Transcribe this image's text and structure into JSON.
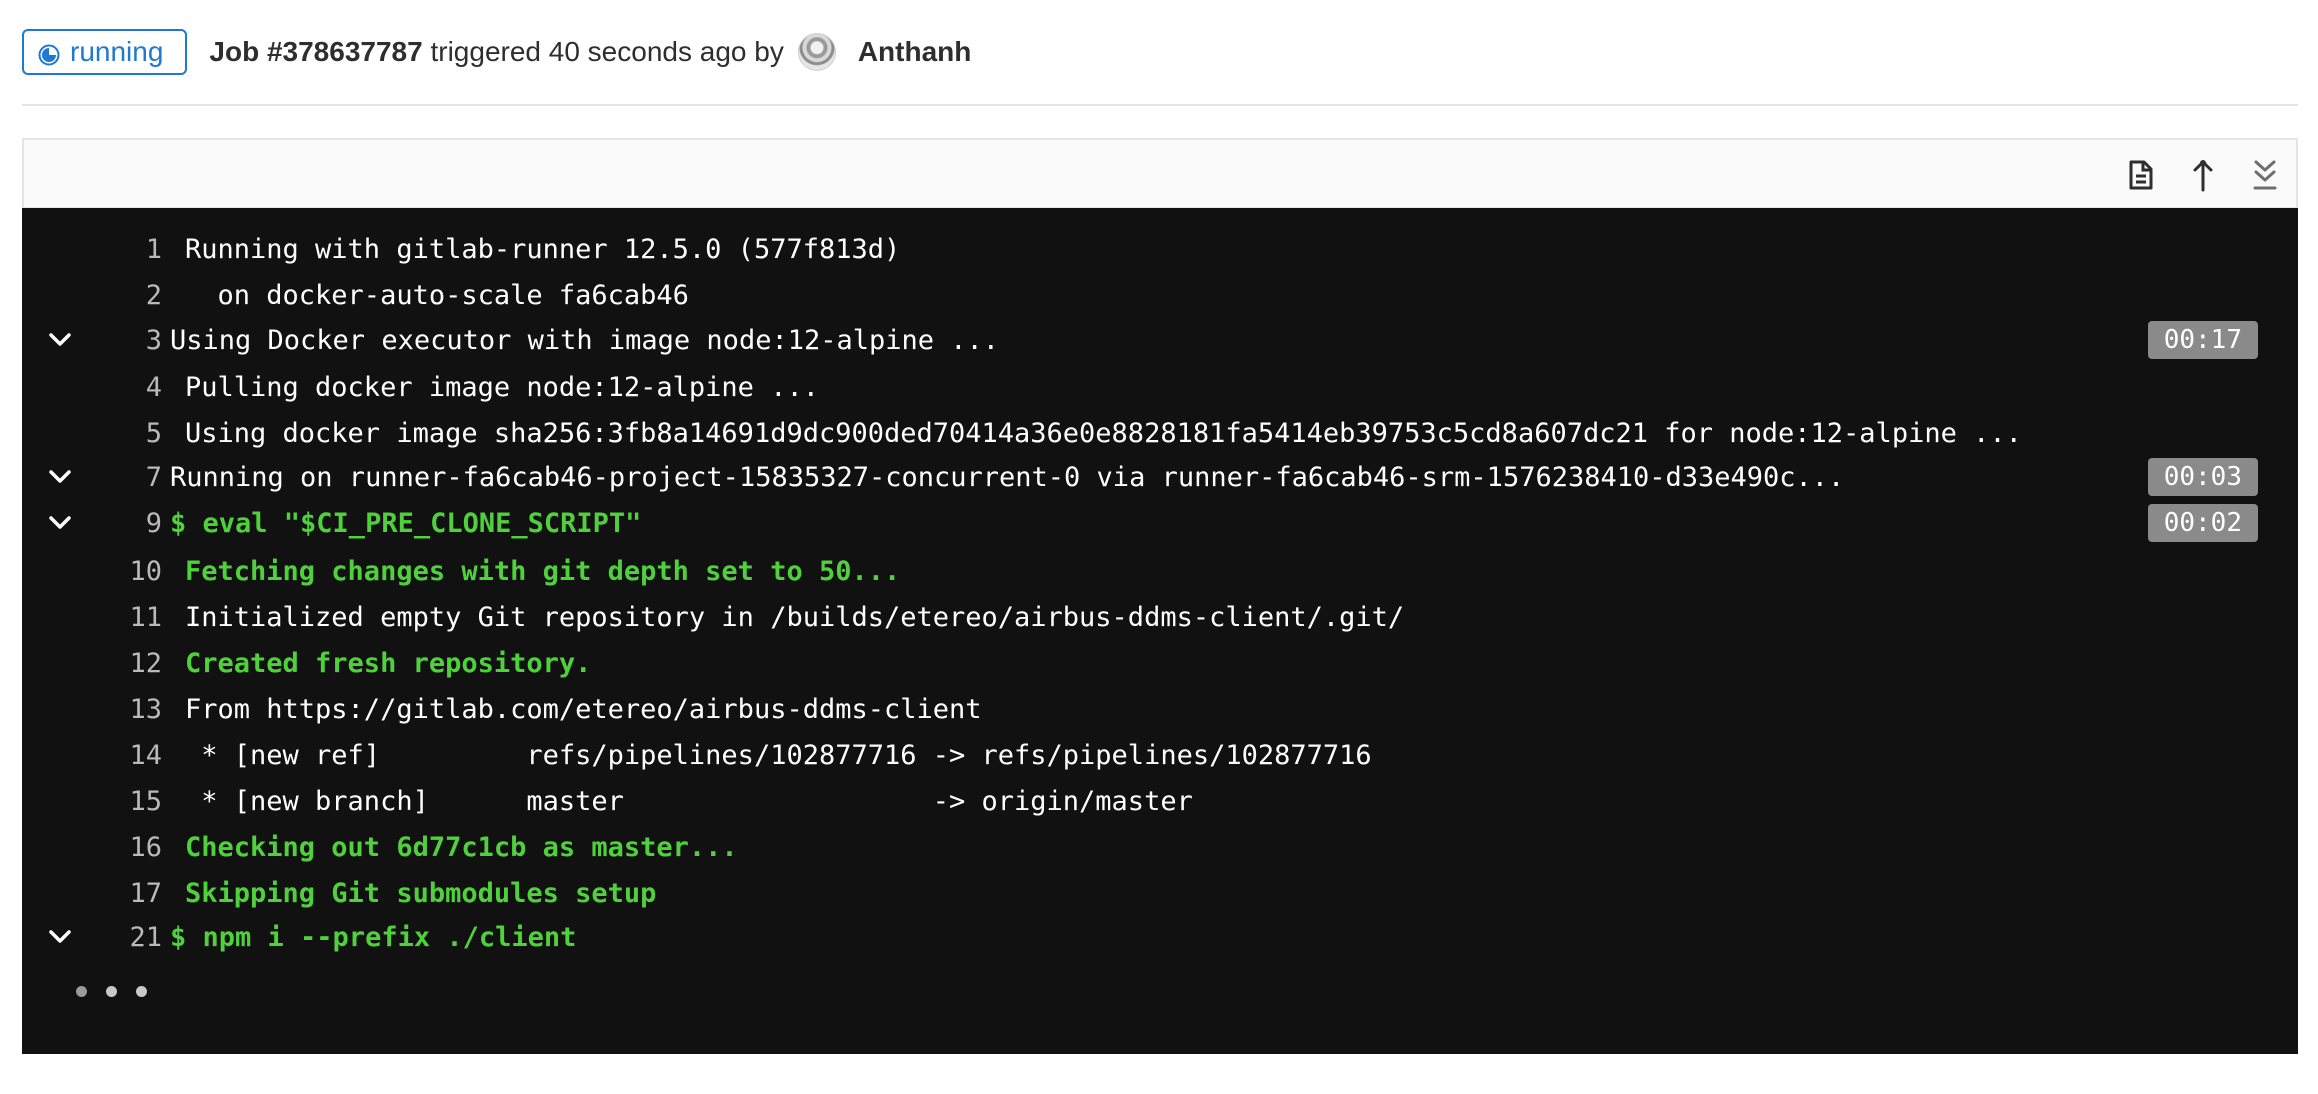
{
  "header": {
    "status": "running",
    "job_id": "Job #378637787",
    "triggered_text": "triggered 40 seconds ago by",
    "author": "Anthanh"
  },
  "toolbar": {
    "icons": [
      "raw-log-icon",
      "scroll-to-top-icon",
      "scroll-to-bottom-icon"
    ]
  },
  "log": {
    "lines": [
      {
        "num": "1",
        "text": "Running with gitlab-runner 12.5.0 (577f813d)"
      },
      {
        "num": "2",
        "text": "  on docker-auto-scale fa6cab46"
      },
      {
        "num": "3",
        "text": "Using Docker executor with image node:12-alpine ...",
        "duration": "00:17"
      },
      {
        "num": "4",
        "text": "Pulling docker image node:12-alpine ..."
      },
      {
        "num": "5",
        "text": "Using docker image sha256:3fb8a14691d9dc900ded70414a36e0e8828181fa5414eb39753c5cd8a607dc21 for node:12-alpine ..."
      },
      {
        "num": "7",
        "text": "Running on runner-fa6cab46-project-15835327-concurrent-0 via runner-fa6cab46-srm-1576238410-d33e490c...",
        "duration": "00:03"
      },
      {
        "num": "9",
        "text": "$ eval \"$CI_PRE_CLONE_SCRIPT\"",
        "duration": "00:02"
      },
      {
        "num": "10",
        "text": "Fetching changes with git depth set to 50..."
      },
      {
        "num": "11",
        "text": "Initialized empty Git repository in /builds/etereo/airbus-ddms-client/.git/"
      },
      {
        "num": "12",
        "text": "Created fresh repository."
      },
      {
        "num": "13",
        "text": "From https://gitlab.com/etereo/airbus-ddms-client"
      },
      {
        "num": "14",
        "text": " * [new ref]         refs/pipelines/102877716 -> refs/pipelines/102877716"
      },
      {
        "num": "15",
        "text": " * [new branch]      master                   -> origin/master"
      },
      {
        "num": "16",
        "text": "Checking out 6d77c1cb as master..."
      },
      {
        "num": "17",
        "text": "Skipping Git submodules setup"
      },
      {
        "num": "21",
        "text": "$ npm i --prefix ./client"
      }
    ]
  },
  "colors": {
    "status_blue": "#1f78d1",
    "log_background": "#111111",
    "log_green": "#4fd13b",
    "duration_badge": "#8a8a8a"
  }
}
